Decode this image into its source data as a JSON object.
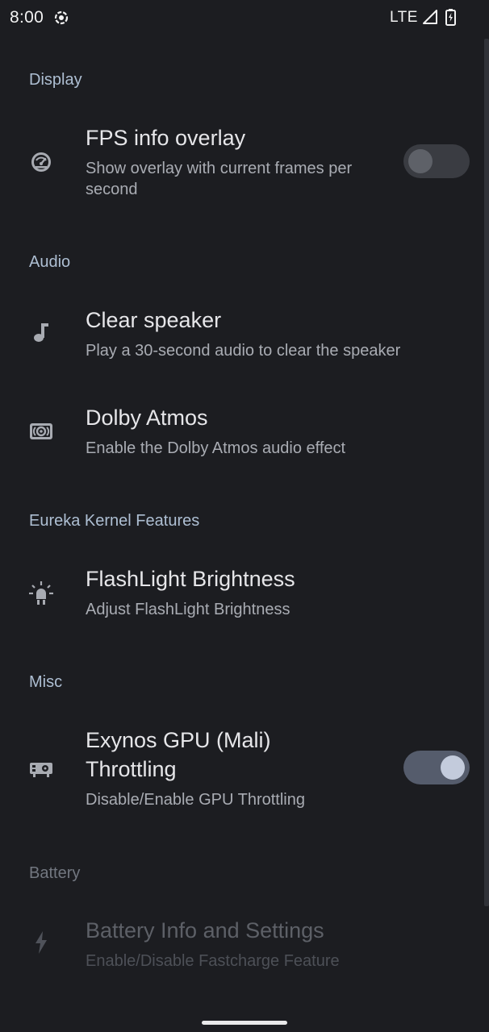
{
  "status_bar": {
    "time": "8:00",
    "network": "LTE"
  },
  "sections": {
    "display": {
      "header": "Display"
    },
    "audio": {
      "header": "Audio"
    },
    "kernel": {
      "header": "Eureka Kernel Features"
    },
    "misc": {
      "header": "Misc"
    },
    "battery": {
      "header": "Battery"
    }
  },
  "prefs": {
    "fps": {
      "title": "FPS info overlay",
      "summary_line1": "Show overlay with current frames per",
      "summary_line2": "second",
      "icon": "gauge-icon",
      "toggle_on": false
    },
    "clear_speaker": {
      "title": "Clear speaker",
      "summary": "Play a 30-second audio to clear the speaker",
      "icon": "music-note-icon"
    },
    "dolby": {
      "title": "Dolby Atmos",
      "summary": "Enable the Dolby Atmos audio effect",
      "icon": "surround-sound-icon"
    },
    "flashlight": {
      "title": "FlashLight Brightness",
      "summary": "Adjust FlashLight Brightness",
      "icon": "flashlight-icon"
    },
    "gpu": {
      "title_line1": "Exynos GPU (Mali)",
      "title_line2": "Throttling",
      "summary": "Disable/Enable GPU Throttling",
      "icon": "gpu-icon",
      "toggle_on": true
    },
    "battery": {
      "title": "Battery Info and Settings",
      "summary": "Enable/Disable Fastcharge Feature",
      "icon": "bolt-icon",
      "enabled": false
    }
  },
  "colors": {
    "background": "#1c1d21",
    "section_header": "#aebfd3",
    "toggle_on_track": "#555c6c",
    "toggle_on_knob": "#c3cbdc",
    "toggle_off_track": "#3a3c42"
  }
}
